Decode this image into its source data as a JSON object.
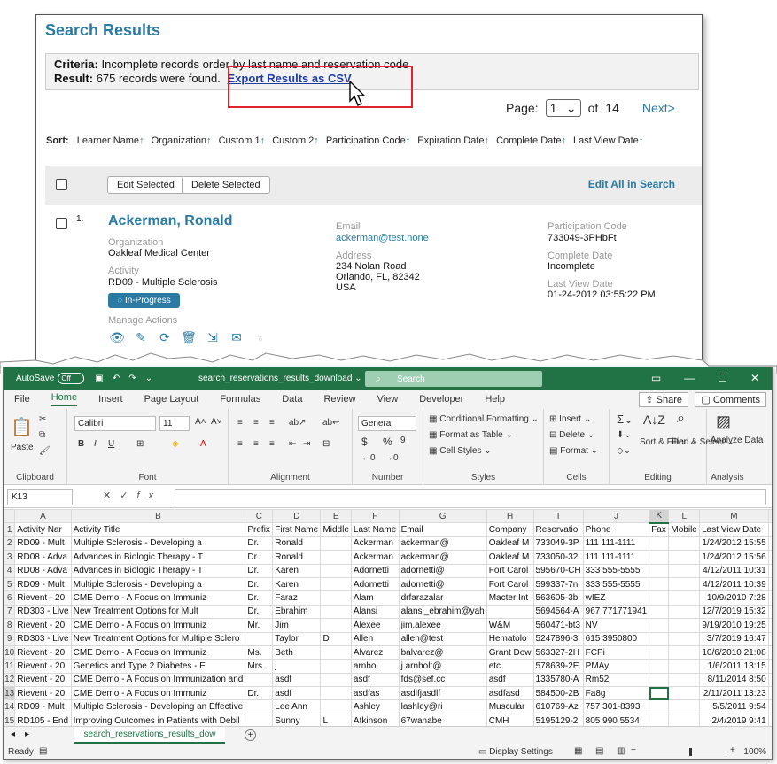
{
  "web": {
    "title": "Search Results",
    "criteria_label": "Criteria:",
    "criteria_text": "Incomplete records order by last name and reservation code",
    "result_label": "Result:",
    "result_text": "675 records were found.",
    "export_link": "Export Results as CSV",
    "page_label": "Page:",
    "page_value": "1",
    "page_of": "of",
    "page_total": "14",
    "next": "Next>",
    "sort_label": "Sort:",
    "sort_fields": [
      "Learner Name",
      "Organization",
      "Custom 1",
      "Custom 2",
      "Participation Code",
      "Expiration Date",
      "Complete Date",
      "Last View Date"
    ],
    "edit_selected": "Edit Selected",
    "delete_selected": "Delete Selected",
    "edit_all": "Edit All in Search",
    "record": {
      "number": "1.",
      "name": "Ackerman, Ronald",
      "organization_label": "Organization",
      "organization": "Oakleaf Medical Center",
      "activity_label": "Activity",
      "activity": "RD09 - Multiple Sclerosis",
      "status": "In-Progress",
      "manage_label": "Manage Actions",
      "email_label": "Email",
      "email": "ackerman@test.none",
      "address_label": "Address",
      "address_1": "234 Nolan Road",
      "address_2": "Orlando, FL, 82342",
      "address_3": "USA",
      "participation_label": "Participation Code",
      "participation_code": "733049-3PHbFt",
      "complete_label": "Complete Date",
      "complete_value": "Incomplete",
      "lastview_label": "Last View Date",
      "lastview_value": "01-24-2012 03:55:22 PM"
    }
  },
  "excel": {
    "autosave": "AutoSave",
    "autosave_state": "Off",
    "filename": "search_reservations_results_download",
    "search_placeholder": "Search",
    "tabs": [
      "File",
      "Home",
      "Insert",
      "Page Layout",
      "Formulas",
      "Data",
      "Review",
      "View",
      "Developer",
      "Help"
    ],
    "share": "Share",
    "comments": "Comments",
    "font_name": "Calibri",
    "font_size": "11",
    "number_format": "General",
    "groups": [
      "Clipboard",
      "Font",
      "Alignment",
      "Number",
      "Styles",
      "Cells",
      "Editing",
      "Analysis"
    ],
    "paste": "Paste",
    "styles_items": [
      "Conditional Formatting",
      "Format as Table",
      "Cell Styles"
    ],
    "cells_items": [
      "Insert",
      "Delete",
      "Format"
    ],
    "editing_items": [
      "Sort & Filter",
      "Find & Select"
    ],
    "analyze": "Analyze Data",
    "namebox": "K13",
    "fx": "fx",
    "columns": [
      "A",
      "B",
      "C",
      "D",
      "E",
      "F",
      "G",
      "H",
      "I",
      "J",
      "K",
      "L",
      "M"
    ],
    "rows": [
      [
        "Activity Nar",
        "Activity Title",
        "Prefix",
        "First Name",
        "Middle",
        "Last Name",
        "Email",
        "Company",
        "Reservatio",
        "Phone",
        "Fax",
        "Mobile",
        "Last View Date"
      ],
      [
        "RD09 - Mult",
        "Multiple Sclerosis - Developing a",
        "Dr.",
        "Ronald",
        "",
        "Ackerman",
        "ackerman@",
        "Oakleaf M",
        "733049-3P",
        "111 111-1111",
        "",
        "",
        "1/24/2012 15:55"
      ],
      [
        "RD08 - Adva",
        "Advances in Biologic Therapy - T",
        "Dr.",
        "Ronald",
        "",
        "Ackerman",
        "ackerman@",
        "Oakleaf M",
        "733050-32",
        "111 111-1111",
        "",
        "",
        "1/24/2012 15:56"
      ],
      [
        "RD08 - Adva",
        "Advances in Biologic Therapy - T",
        "Dr.",
        "Karen",
        "",
        "Adornetti",
        "adornetti@",
        "Fort Carol",
        "595670-CH",
        "333 555-5555",
        "",
        "",
        "4/12/2011 10:31"
      ],
      [
        "RD09 - Mult",
        "Multiple Sclerosis - Developing a",
        "Dr.",
        "Karen",
        "",
        "Adornetti",
        "adornetti@",
        "Fort Carol",
        "599337-7n",
        "333 555-5555",
        "",
        "",
        "4/12/2011 10:39"
      ],
      [
        "Rievent - 20",
        "CME Demo - A Focus on Immuniz",
        "Dr.",
        "Faraz",
        "",
        "Alam",
        "drfarazalar",
        "Macter Int",
        "563605-3b",
        "wIEZ",
        "",
        "",
        "10/9/2010 7:28"
      ],
      [
        "RD303 - Live",
        "New Treatment Options for Mult",
        "Dr.",
        "Ebrahim",
        "",
        "Alansi",
        "alansi_ebrahim@yah",
        "",
        "5694564-A",
        "967 771771941",
        "",
        "",
        "12/7/2019 15:32"
      ],
      [
        "Rievent - 20",
        "CME Demo - A Focus on Immuniz",
        "Mr.",
        "Jim",
        "",
        "Alexee",
        "jim.alexee",
        "W&M",
        "560471-bt3",
        "NV",
        "",
        "",
        "9/19/2010 19:25"
      ],
      [
        "RD303 - Live",
        "New Treatment Options for Multiple Sclero",
        "",
        "Taylor",
        "D",
        "Allen",
        "allen@test",
        "Hematolo",
        "5247896-3",
        "615 3950800",
        "",
        "",
        "3/7/2019 16:47"
      ],
      [
        "Rievent - 20",
        "CME Demo - A Focus on Immuniz",
        "Ms.",
        "Beth",
        "",
        "Alvarez",
        "balvarez@",
        "Grant Dow",
        "563327-2H",
        "FCPi",
        "",
        "",
        "10/6/2010 21:08"
      ],
      [
        "Rievent - 20",
        "Genetics and Type 2 Diabetes - E",
        "Mrs.",
        "j",
        "",
        "arnhol",
        "j.arnholt@",
        "etc",
        "578639-2E",
        "PMAy",
        "",
        "",
        "1/6/2011 13:15"
      ],
      [
        "Rievent - 20",
        "CME Demo - A Focus on Immunization and",
        "",
        "asdf",
        "",
        "asdf",
        "fds@sef.cc",
        "asdf",
        "1335780-A",
        "Rm52",
        "",
        "",
        "8/11/2014 8:50"
      ],
      [
        "Rievent - 20",
        "CME Demo - A Focus on Immuniz",
        "Dr.",
        "asdf",
        "",
        "asdfas",
        "asdlfjasdlf",
        "asdfasd",
        "584500-2B",
        "Fa8g",
        "",
        "",
        "2/11/2011 13:23"
      ],
      [
        "RD09 - Mult",
        "Multiple Sclerosis - Developing an Effective",
        "",
        "Lee Ann",
        "",
        "Ashley",
        "lashley@ri",
        "Muscular",
        "610769-Az",
        "757 301-8393",
        "",
        "",
        "5/5/2011 9:54"
      ],
      [
        "RD105 - End",
        "Improving Outcomes in Patients with Debil",
        "",
        "Sunny",
        "L",
        "Atkinson",
        "67wanabe",
        "CMH",
        "5195129-2",
        "805 990 5534",
        "",
        "",
        "2/4/2019 9:41"
      ]
    ],
    "sheet_tab": "search_reservations_results_dow",
    "status_ready": "Ready",
    "display_settings": "Display Settings",
    "zoom": "100%"
  }
}
